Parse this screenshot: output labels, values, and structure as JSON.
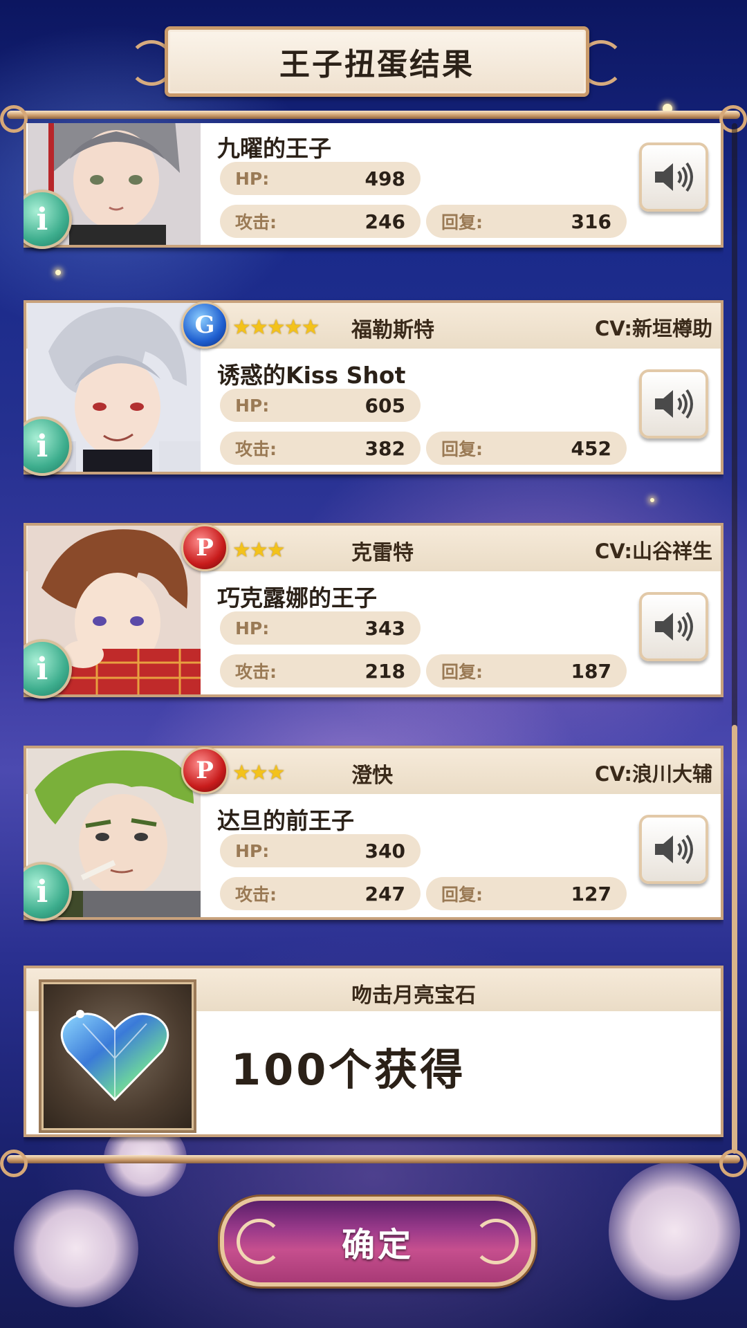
{
  "header": {
    "title": "王子扭蛋结果"
  },
  "cards": [
    {
      "name": "",
      "rarity": "",
      "stars": "",
      "cv": "",
      "subtitle": "九曜的王子",
      "hp_label": "HP:",
      "hp": "498",
      "atk_label": "攻击:",
      "atk": "246",
      "rec_label": "回复:",
      "rec": "316"
    },
    {
      "name": "福勒斯特",
      "rarity": "G",
      "stars": "★★★★★",
      "cv": "CV:新垣樽助",
      "subtitle": "诱惑的Kiss Shot",
      "hp_label": "HP:",
      "hp": "605",
      "atk_label": "攻击:",
      "atk": "382",
      "rec_label": "回复:",
      "rec": "452"
    },
    {
      "name": "克雷特",
      "rarity": "P",
      "stars": "★★★",
      "cv": "CV:山谷祥生",
      "subtitle": "巧克露娜的王子",
      "hp_label": "HP:",
      "hp": "343",
      "atk_label": "攻击:",
      "atk": "218",
      "rec_label": "回复:",
      "rec": "187"
    },
    {
      "name": "澄快",
      "rarity": "P",
      "stars": "★★★",
      "cv": "CV:浪川大辅",
      "subtitle": "达旦的前王子",
      "hp_label": "HP:",
      "hp": "340",
      "atk_label": "攻击:",
      "atk": "247",
      "rec_label": "回复:",
      "rec": "127"
    }
  ],
  "gem": {
    "title": "吻击月亮宝石",
    "count_text": "100个获得"
  },
  "info_glyph": "i",
  "confirm": {
    "label": "确定"
  },
  "colors": {
    "accent_gold": "#c8a27c",
    "confirm_pink": "#c64f8e",
    "info_teal": "#3eae8e"
  }
}
